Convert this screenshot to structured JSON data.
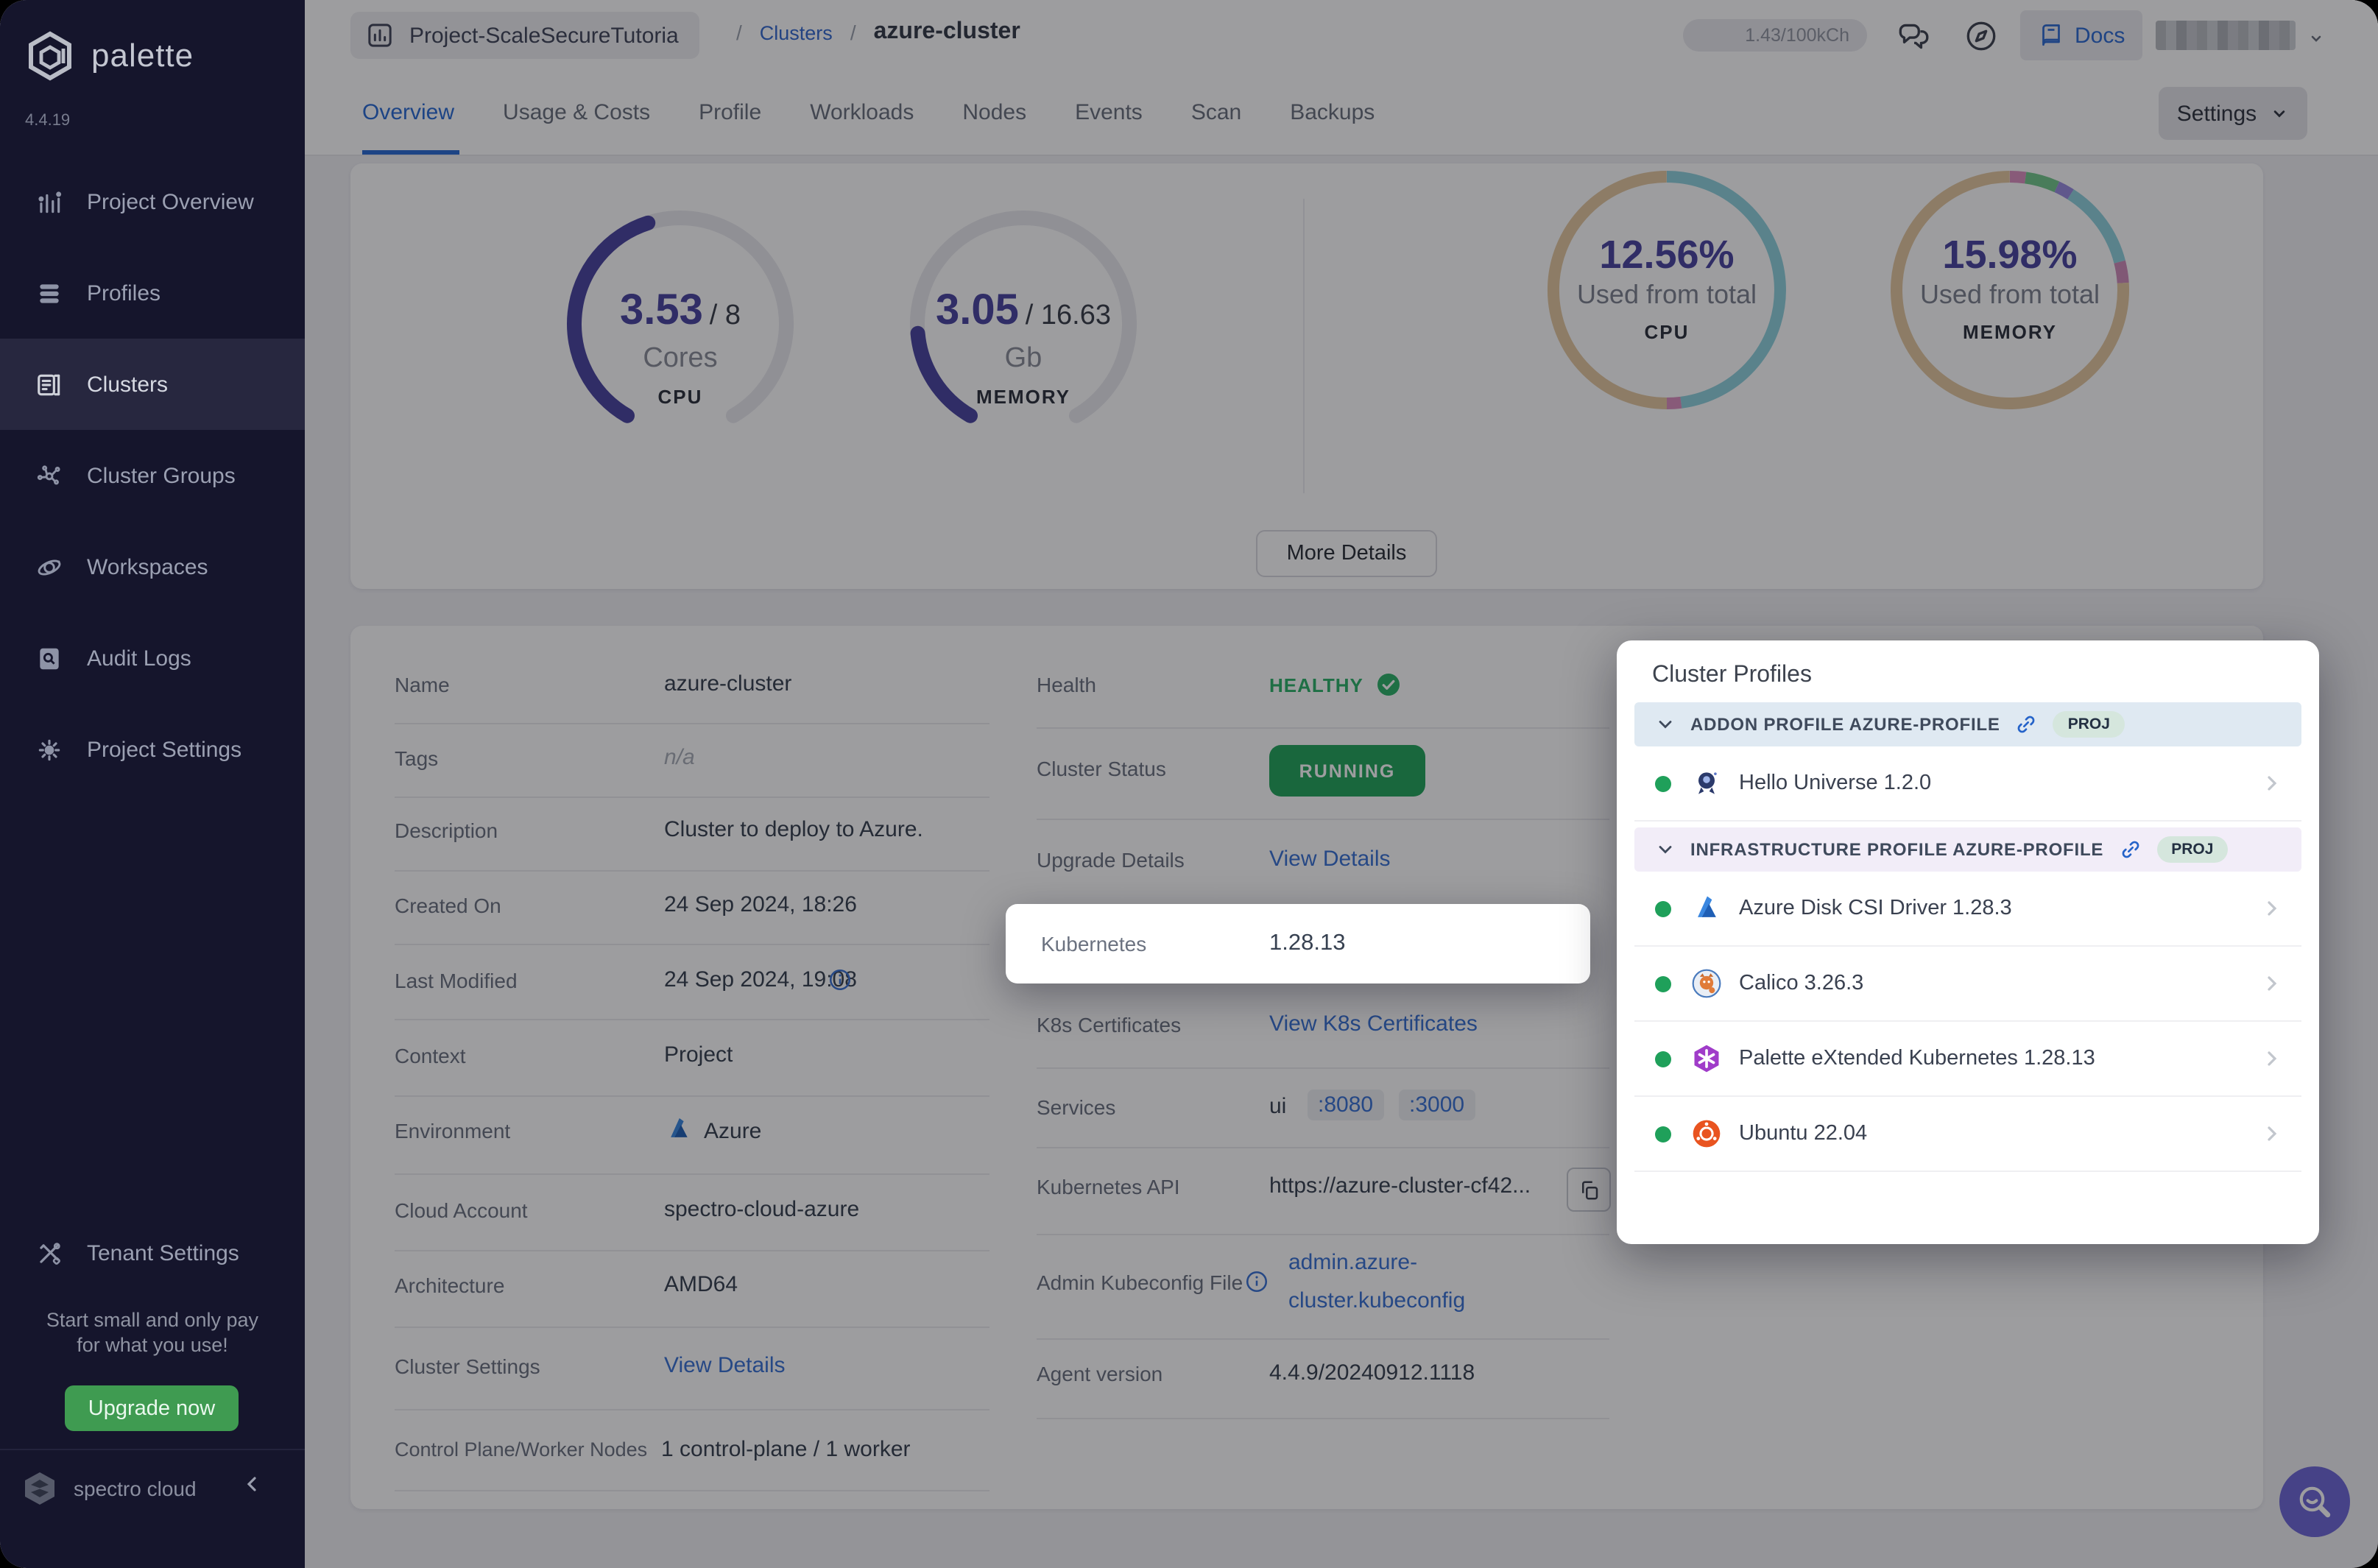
{
  "app": {
    "brand": "palette",
    "version": "4.4.19",
    "footer_brand": "spectro cloud"
  },
  "sidebar": {
    "items": [
      {
        "label": "Project Overview",
        "icon": "bar-chart"
      },
      {
        "label": "Profiles",
        "icon": "layers"
      },
      {
        "label": "Clusters",
        "icon": "server-list"
      },
      {
        "label": "Cluster Groups",
        "icon": "network-nodes"
      },
      {
        "label": "Workspaces",
        "icon": "orbit"
      },
      {
        "label": "Audit Logs",
        "icon": "doc-magnifier"
      },
      {
        "label": "Project Settings",
        "icon": "gear"
      }
    ],
    "active_item": "Clusters",
    "tenant_label": "Tenant Settings",
    "promo_line1": "Start small and only pay",
    "promo_line2": "for what you use!",
    "upgrade_label": "Upgrade now"
  },
  "topbar": {
    "project": "Project-ScaleSecureTutoria",
    "sep1": "/",
    "sep2": "/",
    "clusters_link": "Clusters",
    "cluster_name": "azure-cluster",
    "usage_pill": "1.43/100kCh",
    "docs_label": "Docs"
  },
  "tabs": {
    "items": [
      {
        "label": "Overview"
      },
      {
        "label": "Usage & Costs"
      },
      {
        "label": "Profile"
      },
      {
        "label": "Workloads"
      },
      {
        "label": "Nodes"
      },
      {
        "label": "Events"
      },
      {
        "label": "Scan"
      },
      {
        "label": "Backups"
      }
    ],
    "active": "Overview",
    "settings_label": "Settings"
  },
  "overview": {
    "more_details_label": "More Details"
  },
  "details": {
    "name_label": "Name",
    "name_value": "azure-cluster",
    "tags_label": "Tags",
    "tags_value": "n/a",
    "description_label": "Description",
    "description_value": "Cluster to deploy to Azure.",
    "created_label": "Created On",
    "created_value": "24 Sep 2024, 18:26",
    "modified_label": "Last Modified",
    "modified_value": "24 Sep 2024, 19:08",
    "context_label": "Context",
    "context_value": "Project",
    "environment_label": "Environment",
    "environment_value": "Azure",
    "cloud_account_label": "Cloud Account",
    "cloud_account_value": "spectro-cloud-azure",
    "architecture_label": "Architecture",
    "architecture_value": "AMD64",
    "cluster_settings_label": "Cluster Settings",
    "cluster_settings_link": "View Details",
    "nodes_label": "Control Plane/Worker Nodes",
    "nodes_value": "1 control-plane / 1 worker",
    "health_label": "Health",
    "health_value": "HEALTHY",
    "status_label": "Cluster Status",
    "status_value": "RUNNING",
    "upgrade_label": "Upgrade Details",
    "upgrade_link": "View Details",
    "kubernetes_label": "Kubernetes",
    "kubernetes_value": "1.28.13",
    "k8s_cert_label": "K8s Certificates",
    "k8s_cert_link": "View K8s Certificates",
    "services_label": "Services",
    "services_name": "ui",
    "services_port1": ":8080",
    "services_port2": ":3000",
    "api_label": "Kubernetes API",
    "api_value": "https://azure-cluster-cf42...",
    "kubeconfig_label": "Admin Kubeconfig File",
    "kubeconfig_link_line1": "admin.azure-",
    "kubeconfig_link_line2": "cluster.kubeconfig",
    "agent_label": "Agent version",
    "agent_value": "4.4.9/20240912.1118"
  },
  "profiles_panel": {
    "title": "Cluster Profiles",
    "addon_header": "ADDON PROFILE AZURE-PROFILE",
    "addon_badge": "PROJ",
    "infra_header": "INFRASTRUCTURE PROFILE AZURE-PROFILE",
    "infra_badge": "PROJ",
    "addon_items": [
      {
        "name": "Hello Universe 1.2.0",
        "icon": "hello-universe",
        "status_color": "#1fa05a"
      }
    ],
    "infra_items": [
      {
        "name": "Azure Disk CSI Driver 1.28.3",
        "icon": "azure",
        "status_color": "#1fa05a"
      },
      {
        "name": "Calico 3.26.3",
        "icon": "calico",
        "status_color": "#1fa05a"
      },
      {
        "name": "Palette eXtended Kubernetes 1.28.13",
        "icon": "pxk-hexagon",
        "status_color": "#1fa05a"
      },
      {
        "name": "Ubuntu 22.04",
        "icon": "ubuntu",
        "status_color": "#1fa05a"
      }
    ]
  },
  "colors": {
    "accent_blue": "#2b6cd4",
    "link_blue": "#3a72d4",
    "gauge_indigo": "#4a45a0",
    "healthy_green": "#2eb26a",
    "running_green": "#23a55c",
    "upgrade_green": "#3f9b51",
    "sidebar_bg": "#15152c",
    "donut_teal": "#8fd2de",
    "donut_tan": "#e5c9a0",
    "donut_pink": "#dc8fc0",
    "donut_green": "#74c98c",
    "donut_purple": "#9a8ce0"
  },
  "chart_data": [
    {
      "id": "cpu-gauge",
      "type": "gauge",
      "title": "CPU cores usage gauge",
      "value": "3.53",
      "total": "/ 8",
      "unit": "Cores",
      "caption": "CPU",
      "value_num": 3.53,
      "total_num": 8,
      "fill": 0.441,
      "start": 210,
      "sweep": 300,
      "color": "#4a45a0",
      "track": "#e9e9ef"
    },
    {
      "id": "memory-gauge",
      "type": "gauge",
      "title": "Memory Gb usage gauge",
      "value": "3.05",
      "total": "/ 16.63",
      "unit": "Gb",
      "caption": "MEMORY",
      "value_num": 3.05,
      "total_num": 16.63,
      "fill": 0.183,
      "start": 210,
      "sweep": 300,
      "color": "#4a45a0",
      "track": "#e9e9ef"
    },
    {
      "id": "cpu-donut",
      "type": "donut",
      "title": "CPU used from total",
      "percent": "12.56%",
      "percent_num": 12.56,
      "label": "Used from total",
      "caption": "CPU",
      "segments": [
        {
          "name": "teal",
          "color": "#8fd2de",
          "pct": 48
        },
        {
          "name": "pink",
          "color": "#dc8fc0",
          "pct": 2
        },
        {
          "name": "tan",
          "color": "#e5c9a0",
          "pct": 50
        }
      ]
    },
    {
      "id": "memory-donut",
      "type": "donut",
      "title": "Memory used from total",
      "percent": "15.98%",
      "percent_num": 15.98,
      "label": "Used from total",
      "caption": "MEMORY",
      "segments": [
        {
          "name": "pink",
          "color": "#dc8fc0",
          "pct": 2.2
        },
        {
          "name": "green",
          "color": "#74c98c",
          "pct": 4.6
        },
        {
          "name": "purple",
          "color": "#9a8ce0",
          "pct": 2.2
        },
        {
          "name": "teal",
          "color": "#8fd2de",
          "pct": 12
        },
        {
          "name": "pink2",
          "color": "#cf8cba",
          "pct": 3
        },
        {
          "name": "tan",
          "color": "#e5c9a0",
          "pct": 76
        }
      ]
    }
  ]
}
